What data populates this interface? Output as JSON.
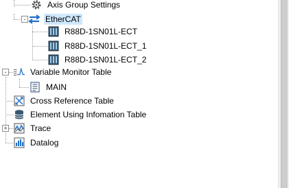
{
  "tree": {
    "axis_group_settings": "Axis Group Settings",
    "ethercat": "EtherCAT",
    "devices": [
      "R88D-1SN01L-ECT",
      "R88D-1SN01L-ECT_1",
      "R88D-1SN01L-ECT_2"
    ],
    "variable_monitor_table": "Variable Monitor Table",
    "main": "MAIN",
    "cross_reference_table": "Cross Reference Table",
    "element_using_information_table": "Element Using Infomation Table",
    "trace": "Trace",
    "datalog": "Datalog"
  },
  "expanders": {
    "collapsed": "+",
    "expanded": "-"
  },
  "icons": {
    "axis_group_settings": "gear-icon",
    "ethercat": "ethercat-icon",
    "device": "servo-drive-icon",
    "variable_monitor_table": "monitor-wave-icon",
    "main": "document-icon",
    "cross_reference_table": "cross-reference-icon",
    "element_using_information_table": "database-icon",
    "trace": "trace-icon",
    "datalog": "datalog-icon"
  },
  "colors": {
    "selection": "#cfe8fc",
    "accent_blue": "#1f6fc5"
  }
}
